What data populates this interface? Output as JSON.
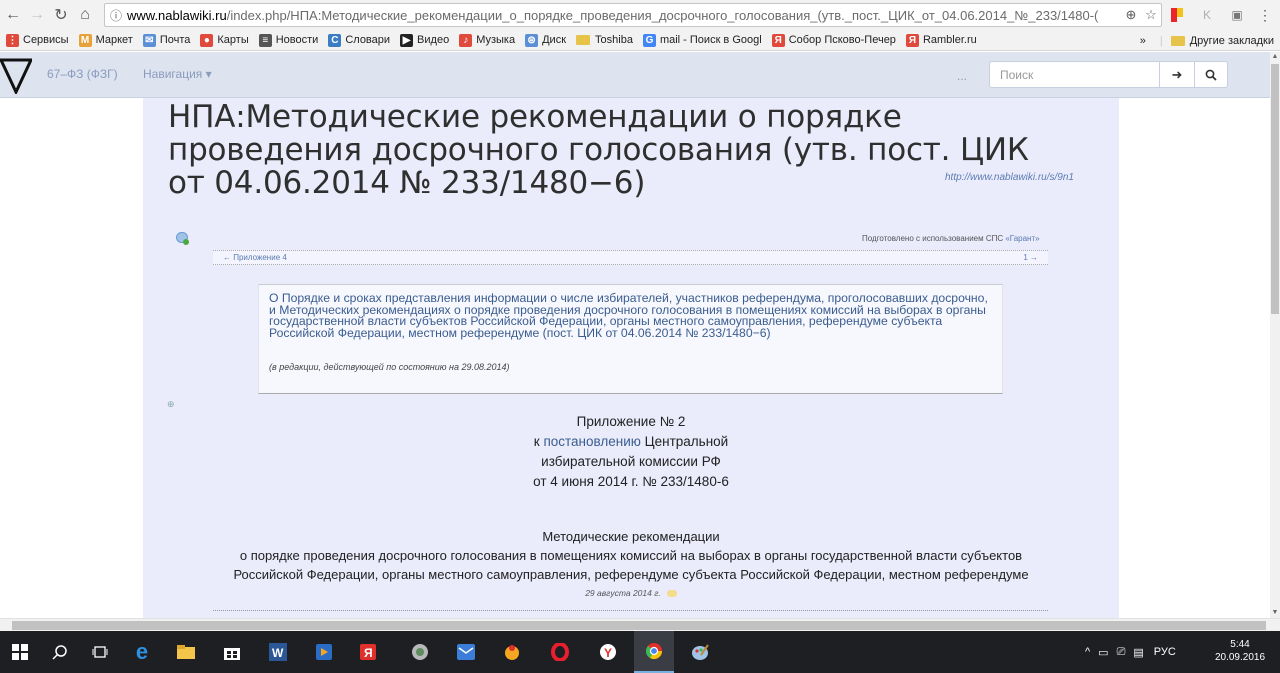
{
  "browser": {
    "url_host": "www.nablawiki.ru",
    "url_path": "/index.php/НПА:Методические_рекомендации_о_порядке_проведения_досрочного_голосования_(утв._пост._ЦИК_от_04.06.2014_№_233/1480-("
  },
  "bookmarks": {
    "items": [
      {
        "label": "Сервисы",
        "color": "#e04a3c"
      },
      {
        "label": "Маркет",
        "color": "#e8a23a"
      },
      {
        "label": "Почта",
        "color": "#5b8fd6"
      },
      {
        "label": "Карты",
        "color": "#e04a3c"
      },
      {
        "label": "Новости",
        "color": "#555555"
      },
      {
        "label": "Словари",
        "color": "#3b7dc4"
      },
      {
        "label": "Видео",
        "color": "#222222"
      },
      {
        "label": "Музыка",
        "color": "#e04a3c"
      },
      {
        "label": "Диск",
        "color": "#5b8fd6"
      },
      {
        "label": "Toshiba",
        "color": "#e8c34a"
      },
      {
        "label": "mail - Поиск в Googl",
        "color": "#4285f4"
      },
      {
        "label": "Собор Псково-Печер",
        "color": "#e04a3c"
      },
      {
        "label": "Rambler.ru",
        "color": "#e04a3c"
      }
    ],
    "overflow": "»",
    "other": "Другие закладки"
  },
  "site": {
    "brand": "67–ФЗ (ФЗГ)",
    "nav_menu": "Навигация ▾",
    "ellipsis": "...",
    "search_placeholder": "Поиск"
  },
  "page": {
    "title": "НПА:Методические рекомендации о порядке проведения досрочного голосования (утв. пост. ЦИК от 04.06.2014 № 233/1480−6)",
    "short_link": "http://www.nablawiki.ru/s/9n1",
    "prepared_text": "Подготовлено с использованием СПС ",
    "prepared_link": "«Гарант»",
    "prev_link": "← Приложение 4",
    "next_link": "1 →",
    "doc_title": "О Порядке и сроках представления информации о числе избирателей, участников референдума, проголосовавших досрочно, и Методических рекомендациях о порядке проведения досрочного голосования в помещениях комиссий на выборах в органы государственной власти субъектов Российской Федерации, органы местного самоуправления, референдуме субъекта Российской Федерации, местном референдуме (пост. ЦИК от 04.06.2014 № 233/1480−6)",
    "doc_subtitle": "(в редакции, действующей по состоянию на 29.08.2014)",
    "appendix_line1": "Приложение № 2",
    "appendix_line2_prefix": "к ",
    "appendix_line2_link": "постановлению",
    "appendix_line2_suffix": " Центральной",
    "appendix_line3": "избирательной комиссии РФ",
    "appendix_line4": "от 4 июня 2014 г. № 233/1480-6",
    "methods_line1": "Методические рекомендации",
    "methods_line2": "о порядке проведения досрочного голосования в помещениях комиссий на выборах в органы государственной власти субъектов",
    "methods_line3": "Российской Федерации, органы местного самоуправления, референдуме субъекта Российской Федерации, местном референдуме",
    "date_line": "29 августа 2014 г."
  },
  "taskbar": {
    "lang": "РУС",
    "time": "5:44",
    "date": "20.09.2016"
  }
}
